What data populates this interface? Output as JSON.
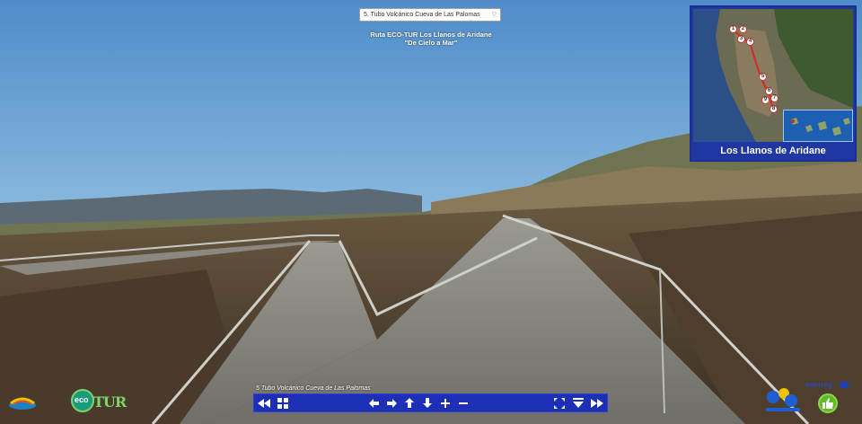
{
  "scene_selector": {
    "value": "5. Tubo Volcánico Cueva de Las Palomas",
    "icon": "chevron-down-icon"
  },
  "route": {
    "line1": "Ruta ECO-TUR Los Llanos de Aridane",
    "line2": "\"De Cielo a Mar\""
  },
  "minimap": {
    "caption": "Los Llanos de Aridane",
    "points": [
      "1",
      "2",
      "3",
      "4",
      "5",
      "6",
      "7",
      "8",
      "9"
    ],
    "route_color": "#d62828"
  },
  "viewer": {
    "caption": "5 Tubo Volcánico Cueva de Las Palomas",
    "toolbar_color": "#1d2fb4",
    "toolbar": [
      {
        "name": "previous-scene-button",
        "icon": "double-left-arrow-icon"
      },
      {
        "name": "thumbnails-button",
        "icon": "grid-icon"
      },
      {
        "name": "pan-left-button",
        "icon": "arrow-left-icon"
      },
      {
        "name": "pan-right-button",
        "icon": "arrow-right-icon"
      },
      {
        "name": "pan-up-button",
        "icon": "arrow-up-icon"
      },
      {
        "name": "pan-down-button",
        "icon": "arrow-down-icon"
      },
      {
        "name": "zoom-in-button",
        "icon": "plus-icon"
      },
      {
        "name": "zoom-out-button",
        "icon": "minus-icon"
      },
      {
        "name": "fullscreen-button",
        "icon": "fullscreen-icon"
      },
      {
        "name": "hide-toolbar-button",
        "icon": "eject-icon"
      },
      {
        "name": "next-scene-button",
        "icon": "double-right-arrow-icon"
      }
    ]
  },
  "logos": {
    "ecotur_text": "TUR",
    "eco_text": "eco",
    "eu_text": "Interreg"
  }
}
